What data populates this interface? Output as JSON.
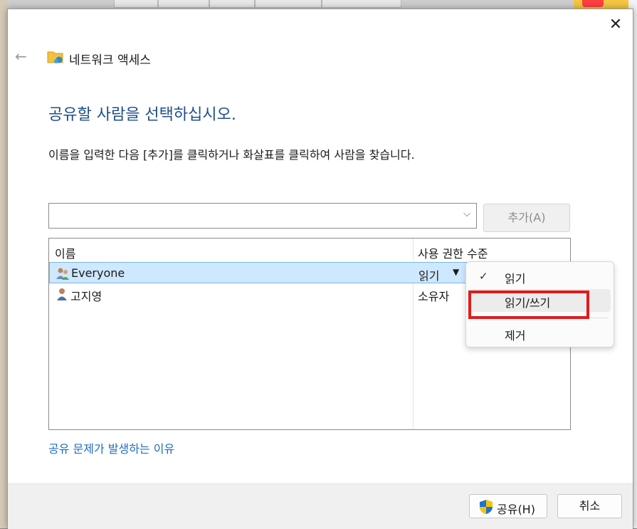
{
  "window": {
    "title": "네트워크 액세스",
    "close_glyph": "✕",
    "back_glyph": "←"
  },
  "heading": "공유할 사람을 선택하십시오.",
  "instruction": "이름을 입력한 다음 [추가]를 클릭하거나 화살표를 클릭하여 사람을 찾습니다.",
  "name_input": {
    "value": "",
    "chevron": "⌵"
  },
  "add_button": {
    "label": "추가(A)"
  },
  "list": {
    "columns": {
      "name": "이름",
      "permission": "사용 권한 수준"
    },
    "rows": [
      {
        "name": "Everyone",
        "permission": "읽기",
        "caret": "▼"
      },
      {
        "name": "고지영",
        "permission": "소유자"
      }
    ]
  },
  "help_link": "공유 문제가 발생하는 이유",
  "footer": {
    "share_label": "공유(H)",
    "cancel_label": "취소"
  },
  "permission_menu": {
    "items": [
      {
        "label": "읽기",
        "check": "✓"
      },
      {
        "label": "읽기/쓰기"
      },
      {
        "label": "제거"
      }
    ]
  },
  "colors": {
    "heading": "#1f4e8c",
    "link": "#1f6cc4",
    "selection": "#cde8ff",
    "highlight": "#e11b1b"
  }
}
